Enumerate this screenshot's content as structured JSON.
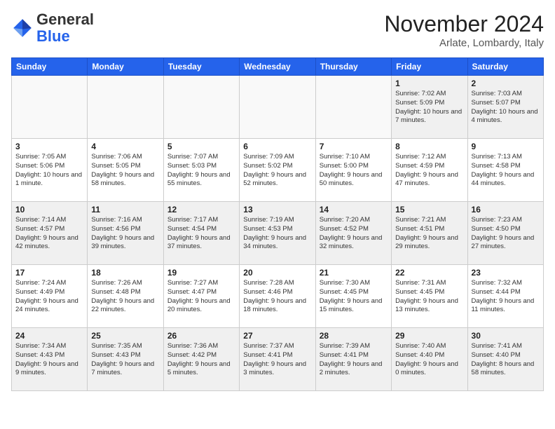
{
  "header": {
    "logo_general": "General",
    "logo_blue": "Blue",
    "month_title": "November 2024",
    "location": "Arlate, Lombardy, Italy"
  },
  "days_of_week": [
    "Sunday",
    "Monday",
    "Tuesday",
    "Wednesday",
    "Thursday",
    "Friday",
    "Saturday"
  ],
  "weeks": [
    [
      {
        "day": "",
        "info": ""
      },
      {
        "day": "",
        "info": ""
      },
      {
        "day": "",
        "info": ""
      },
      {
        "day": "",
        "info": ""
      },
      {
        "day": "",
        "info": ""
      },
      {
        "day": "1",
        "info": "Sunrise: 7:02 AM\nSunset: 5:09 PM\nDaylight: 10 hours and 7 minutes."
      },
      {
        "day": "2",
        "info": "Sunrise: 7:03 AM\nSunset: 5:07 PM\nDaylight: 10 hours and 4 minutes."
      }
    ],
    [
      {
        "day": "3",
        "info": "Sunrise: 7:05 AM\nSunset: 5:06 PM\nDaylight: 10 hours and 1 minute."
      },
      {
        "day": "4",
        "info": "Sunrise: 7:06 AM\nSunset: 5:05 PM\nDaylight: 9 hours and 58 minutes."
      },
      {
        "day": "5",
        "info": "Sunrise: 7:07 AM\nSunset: 5:03 PM\nDaylight: 9 hours and 55 minutes."
      },
      {
        "day": "6",
        "info": "Sunrise: 7:09 AM\nSunset: 5:02 PM\nDaylight: 9 hours and 52 minutes."
      },
      {
        "day": "7",
        "info": "Sunrise: 7:10 AM\nSunset: 5:00 PM\nDaylight: 9 hours and 50 minutes."
      },
      {
        "day": "8",
        "info": "Sunrise: 7:12 AM\nSunset: 4:59 PM\nDaylight: 9 hours and 47 minutes."
      },
      {
        "day": "9",
        "info": "Sunrise: 7:13 AM\nSunset: 4:58 PM\nDaylight: 9 hours and 44 minutes."
      }
    ],
    [
      {
        "day": "10",
        "info": "Sunrise: 7:14 AM\nSunset: 4:57 PM\nDaylight: 9 hours and 42 minutes."
      },
      {
        "day": "11",
        "info": "Sunrise: 7:16 AM\nSunset: 4:56 PM\nDaylight: 9 hours and 39 minutes."
      },
      {
        "day": "12",
        "info": "Sunrise: 7:17 AM\nSunset: 4:54 PM\nDaylight: 9 hours and 37 minutes."
      },
      {
        "day": "13",
        "info": "Sunrise: 7:19 AM\nSunset: 4:53 PM\nDaylight: 9 hours and 34 minutes."
      },
      {
        "day": "14",
        "info": "Sunrise: 7:20 AM\nSunset: 4:52 PM\nDaylight: 9 hours and 32 minutes."
      },
      {
        "day": "15",
        "info": "Sunrise: 7:21 AM\nSunset: 4:51 PM\nDaylight: 9 hours and 29 minutes."
      },
      {
        "day": "16",
        "info": "Sunrise: 7:23 AM\nSunset: 4:50 PM\nDaylight: 9 hours and 27 minutes."
      }
    ],
    [
      {
        "day": "17",
        "info": "Sunrise: 7:24 AM\nSunset: 4:49 PM\nDaylight: 9 hours and 24 minutes."
      },
      {
        "day": "18",
        "info": "Sunrise: 7:26 AM\nSunset: 4:48 PM\nDaylight: 9 hours and 22 minutes."
      },
      {
        "day": "19",
        "info": "Sunrise: 7:27 AM\nSunset: 4:47 PM\nDaylight: 9 hours and 20 minutes."
      },
      {
        "day": "20",
        "info": "Sunrise: 7:28 AM\nSunset: 4:46 PM\nDaylight: 9 hours and 18 minutes."
      },
      {
        "day": "21",
        "info": "Sunrise: 7:30 AM\nSunset: 4:45 PM\nDaylight: 9 hours and 15 minutes."
      },
      {
        "day": "22",
        "info": "Sunrise: 7:31 AM\nSunset: 4:45 PM\nDaylight: 9 hours and 13 minutes."
      },
      {
        "day": "23",
        "info": "Sunrise: 7:32 AM\nSunset: 4:44 PM\nDaylight: 9 hours and 11 minutes."
      }
    ],
    [
      {
        "day": "24",
        "info": "Sunrise: 7:34 AM\nSunset: 4:43 PM\nDaylight: 9 hours and 9 minutes."
      },
      {
        "day": "25",
        "info": "Sunrise: 7:35 AM\nSunset: 4:43 PM\nDaylight: 9 hours and 7 minutes."
      },
      {
        "day": "26",
        "info": "Sunrise: 7:36 AM\nSunset: 4:42 PM\nDaylight: 9 hours and 5 minutes."
      },
      {
        "day": "27",
        "info": "Sunrise: 7:37 AM\nSunset: 4:41 PM\nDaylight: 9 hours and 3 minutes."
      },
      {
        "day": "28",
        "info": "Sunrise: 7:39 AM\nSunset: 4:41 PM\nDaylight: 9 hours and 2 minutes."
      },
      {
        "day": "29",
        "info": "Sunrise: 7:40 AM\nSunset: 4:40 PM\nDaylight: 9 hours and 0 minutes."
      },
      {
        "day": "30",
        "info": "Sunrise: 7:41 AM\nSunset: 4:40 PM\nDaylight: 8 hours and 58 minutes."
      }
    ]
  ]
}
